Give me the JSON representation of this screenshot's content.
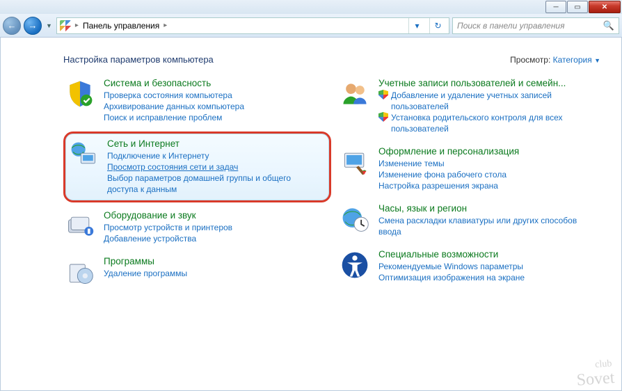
{
  "window": {
    "breadcrumb": "Панель управления",
    "search_placeholder": "Поиск в панели управления"
  },
  "header": {
    "title": "Настройка параметров компьютера",
    "view_label": "Просмотр:",
    "view_value": "Категория"
  },
  "left": [
    {
      "title": "Система и безопасность",
      "links": [
        "Проверка состояния компьютера",
        "Архивирование данных компьютера",
        "Поиск и исправление проблем"
      ]
    },
    {
      "title": "Сеть и Интернет",
      "links": [
        "Подключение к Интернету",
        "Просмотр состояния сети и задач",
        "Выбор параметров домашней группы и общего доступа к данным"
      ]
    },
    {
      "title": "Оборудование и звук",
      "links": [
        "Просмотр устройств и принтеров",
        "Добавление устройства"
      ]
    },
    {
      "title": "Программы",
      "links": [
        "Удаление программы"
      ]
    }
  ],
  "right": [
    {
      "title": "Учетные записи пользователей и семейн...",
      "shield_links": [
        "Добавление и удаление учетных записей пользователей",
        "Установка родительского контроля для всех пользователей"
      ]
    },
    {
      "title": "Оформление и персонализация",
      "links": [
        "Изменение темы",
        "Изменение фона рабочего стола",
        "Настройка разрешения экрана"
      ]
    },
    {
      "title": "Часы, язык и регион",
      "links": [
        "Смена раскладки клавиатуры или других способов ввода"
      ]
    },
    {
      "title": "Специальные возможности",
      "links": [
        "Рекомендуемые Windows параметры",
        "Оптимизация изображения на экране"
      ]
    }
  ],
  "watermark": {
    "top": "club",
    "bottom": "Sovet"
  }
}
